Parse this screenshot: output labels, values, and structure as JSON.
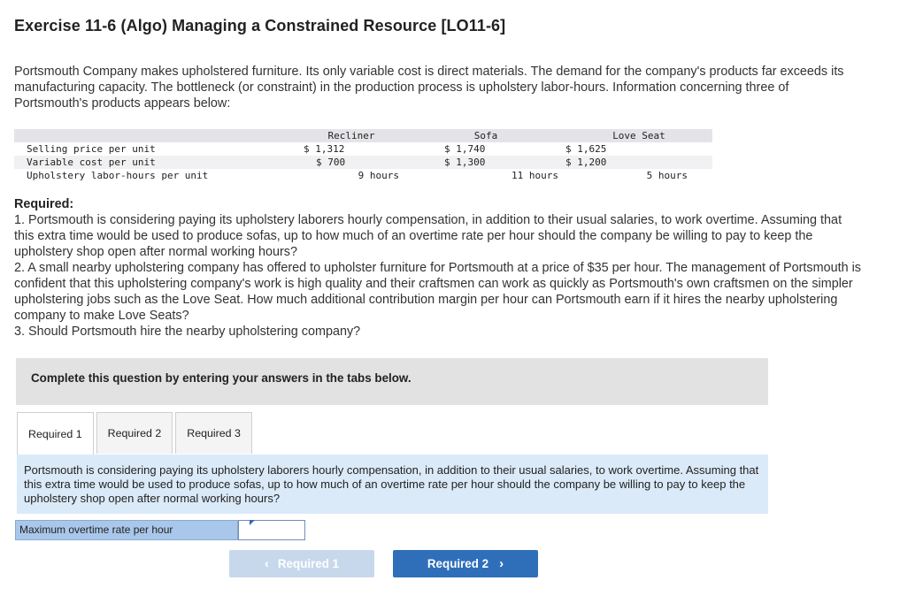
{
  "title": "Exercise 11-6 (Algo) Managing a Constrained Resource [LO11-6]",
  "intro": "Portsmouth Company makes upholstered furniture. Its only variable cost is direct materials. The demand for the company's products far exceeds its manufacturing capacity. The bottleneck (or constraint) in the production process is upholstery labor-hours. Information concerning three of Portsmouth's products appears below:",
  "product_table": {
    "headers": [
      "",
      "Recliner",
      "Sofa",
      "Love Seat"
    ],
    "rows": [
      [
        "Selling price per unit",
        "$ 1,312",
        "$ 1,740",
        "$ 1,625"
      ],
      [
        "Variable cost per unit",
        "$ 700",
        "$ 1,300",
        "$ 1,200"
      ],
      [
        "Upholstery labor-hours per unit",
        "9 hours",
        "11 hours",
        "5 hours"
      ]
    ]
  },
  "required": {
    "heading": "Required:",
    "items": [
      "1. Portsmouth is considering paying its upholstery laborers hourly compensation, in addition to their usual salaries, to work overtime. Assuming that this extra time would be used to produce sofas, up to how much of an overtime rate per hour should the company be willing to pay to keep the upholstery shop open after normal working hours?",
      "2. A small nearby upholstering company has offered to upholster furniture for Portsmouth at a price of $35 per hour. The management of Portsmouth is confident that this upholstering company's work is high quality and their craftsmen can work as quickly as Portsmouth's own craftsmen on the simpler upholstering jobs such as the Love Seat. How much additional contribution margin per hour can Portsmouth earn if it hires the nearby upholstering company to make Love Seats?",
      "3. Should Portsmouth hire the nearby upholstering company?"
    ]
  },
  "instruction": "Complete this question by entering your answers in the tabs below.",
  "tabs": [
    "Required 1",
    "Required 2",
    "Required 3"
  ],
  "active_tab": "Required 1",
  "panel_text": "Portsmouth is considering paying its upholstery laborers hourly compensation, in addition to their usual salaries, to work overtime. Assuming that this extra time would be used to produce sofas, up to how much of an overtime rate per hour should the company be willing to pay to keep the upholstery shop open after normal working hours?",
  "answer": {
    "label": "Maximum overtime rate per hour",
    "value": ""
  },
  "nav": {
    "prev_label": "Required 1",
    "next_label": "Required 2",
    "prev_icon": "chevron-left-icon",
    "next_icon": "chevron-right-icon"
  },
  "colors": {
    "panel_bg": "#dbeaf8",
    "answer_label_bg": "#a9c7ea",
    "next_button": "#2f6fba",
    "prev_button_disabled": "#c8d8ec"
  }
}
